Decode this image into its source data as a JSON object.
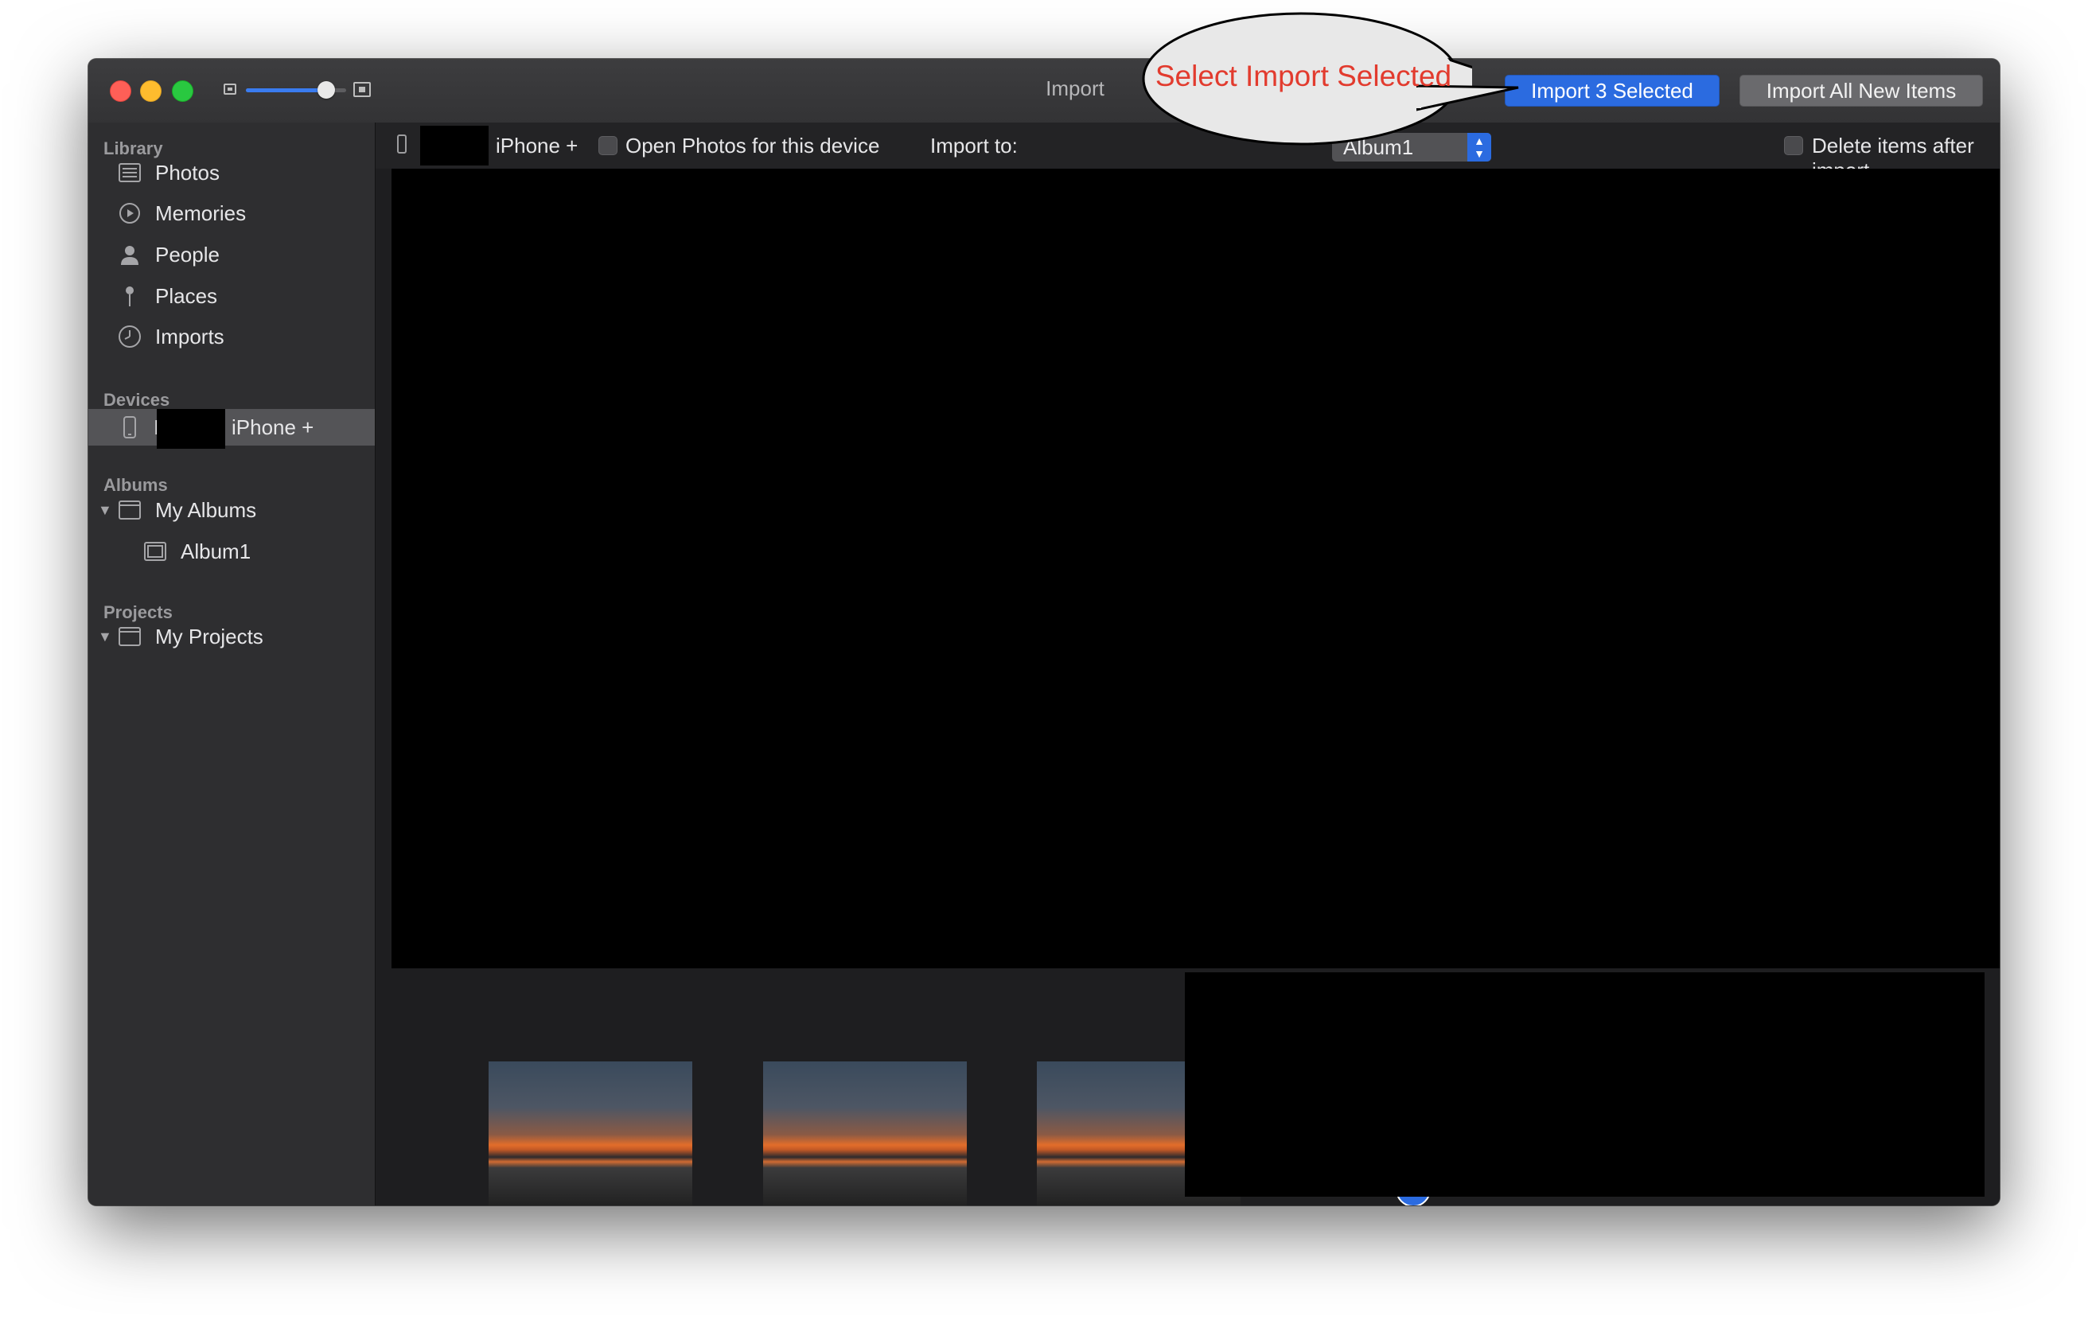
{
  "window": {
    "title": "Import",
    "buttons": {
      "import_selected": "Import 3 Selected",
      "import_all": "Import All New Items"
    },
    "zoom_slider_value": 0.8
  },
  "callout": {
    "text": "Select Import Selected"
  },
  "sidebar": {
    "sections": {
      "library": "Library",
      "devices": "Devices",
      "albums": "Albums",
      "projects": "Projects"
    },
    "library_items": [
      {
        "label": "Photos",
        "icon": "photos-icon"
      },
      {
        "label": "Memories",
        "icon": "memories-icon"
      },
      {
        "label": "People",
        "icon": "person-icon"
      },
      {
        "label": "Places",
        "icon": "pin-icon"
      },
      {
        "label": "Imports",
        "icon": "clock-icon"
      }
    ],
    "device": {
      "label": "iPhone +",
      "prefix": "I",
      "icon": "iphone-icon"
    },
    "albums": {
      "group": "My Albums",
      "child": "Album1"
    },
    "projects": {
      "group": "My Projects"
    }
  },
  "toolbar": {
    "device_name": "iPhone +",
    "open_photos_label": "Open Photos for this device",
    "open_photos_checked": false,
    "import_to_label": "Import to:",
    "import_to_value": "Album1",
    "delete_after_label": "Delete items after import",
    "delete_after_checked": false
  },
  "thumbnails": [
    {
      "selected": true
    },
    {
      "selected": true
    },
    {
      "selected": true
    }
  ],
  "colors": {
    "accent": "#2b6be0",
    "callout_text": "#e23b2e",
    "sidebar_bg": "#2e2e30",
    "selected_row": "#545457"
  }
}
